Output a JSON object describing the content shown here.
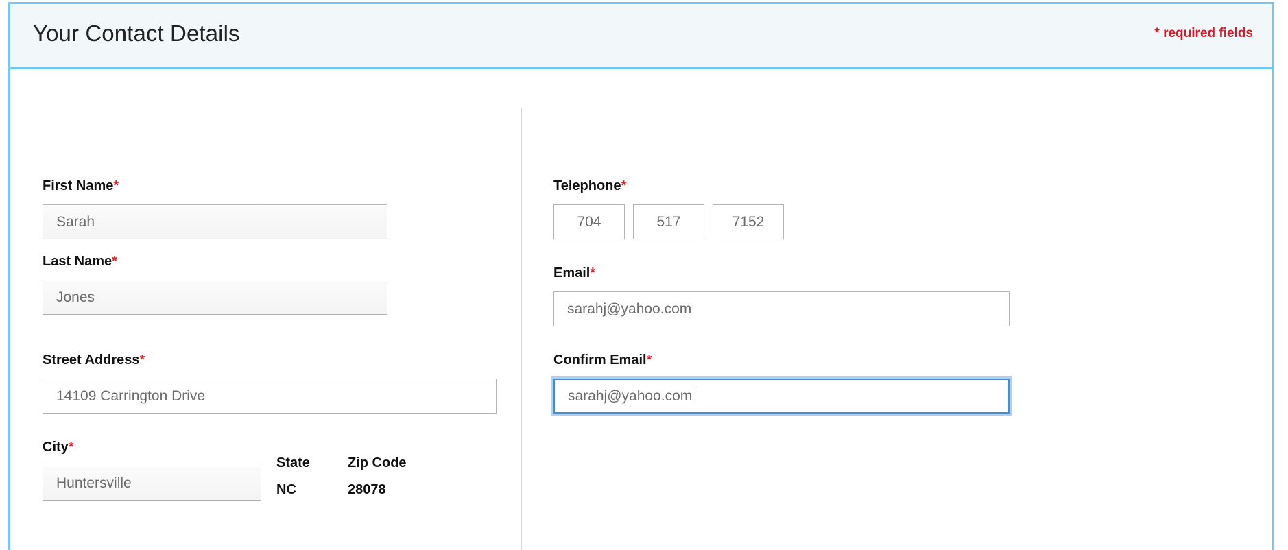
{
  "header": {
    "title": "Your Contact Details",
    "required_note": "* required fields",
    "required_note_color": "#d81826",
    "accent_color": "#6fc9f7",
    "header_background": "#f2f7f9"
  },
  "form": {
    "required_marker": "*",
    "left_column": {
      "first_name": {
        "label": "First Name",
        "value": "Sarah",
        "required": true
      },
      "last_name": {
        "label": "Last Name",
        "value": "Jones",
        "required": true
      },
      "street_address": {
        "label": "Street Address",
        "value": "14109 Carrington Drive",
        "required": true
      },
      "city": {
        "label": "City",
        "value": "Huntersville",
        "required": true
      },
      "state": {
        "label": "State",
        "value": "NC"
      },
      "zip_code": {
        "label": "Zip Code",
        "value": "28078"
      }
    },
    "right_column": {
      "telephone": {
        "label": "Telephone",
        "required": true,
        "area_code": "704",
        "prefix": "517",
        "line_number": "7152"
      },
      "email": {
        "label": "Email",
        "value": "sarahj@yahoo.com",
        "required": true
      },
      "confirm_email": {
        "label": "Confirm Email",
        "value": "sarahj@yahoo.com",
        "required": true,
        "focused": true,
        "focus_color": "#3d8fdd"
      }
    }
  }
}
